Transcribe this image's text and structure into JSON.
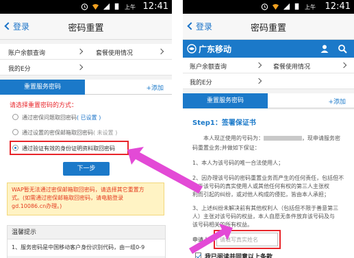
{
  "left": {
    "status": {
      "ampm": "上午",
      "time": "12:41"
    },
    "header": {
      "back": "登录",
      "title": "密码重置"
    },
    "menu": {
      "row1": [
        "账户余额查询",
        "套餐使用情况"
      ],
      "row2": [
        "我的E分"
      ]
    },
    "tabs": {
      "active": "重置服务密码",
      "add": "+添加"
    },
    "form": {
      "prompt": "请选择重置密码的方式：",
      "options": [
        {
          "text": "通过密保问题取回密码",
          "note": "( 已设置 )"
        },
        {
          "text": "通过设置的密保邮箱取回密码",
          "note": "( 未设置 )"
        },
        {
          "text": "通过验证有效的身份证明资料取回密码",
          "note": ""
        }
      ],
      "next": "下一步"
    },
    "notice": {
      "line1": "WAP暂无法通过密保邮箱取回密码，请选择其它重置方",
      "line2": "式。(如需通过密保邮箱取回密码，请电脑登录",
      "line3": "gd.10086.cn办理。)"
    },
    "tips": {
      "title": "温馨提示",
      "line1": "1、服务密码是中国移动客户身份识别代码，由一组0-9"
    }
  },
  "right": {
    "status": {
      "ampm": "上午",
      "time": "12:41"
    },
    "header": {
      "back": "登录",
      "title": "密码重置"
    },
    "brand": {
      "name": "广东移动"
    },
    "menu": {
      "row1": [
        "账户余额查询",
        "套餐使用情况"
      ],
      "row2": [
        "我的E分"
      ]
    },
    "tabs": {
      "active": "重置服务密码",
      "add": "+添加"
    },
    "doc": {
      "step": "Step1：签署保证书",
      "p1a": "本人现正使用的号码为：",
      "p1b": "，现申请服务密",
      "p1c": "码重置业务;并做如下保证：",
      "p2": "1、本人为该号码的唯一合法使用人；",
      "p3a": "2、因办理该号码的密码重置业务而产生的任何责任，包括但不",
      "p3b": "限于该号码的真实使用人或其他任何有权的第三人主张权",
      "p3c": "利而引起的纠纷，或对他人构成的侵犯，皆由本人承担；",
      "p4a": "3、上述纠纷未解决前有其他权利人（包括但不限于善意第三",
      "p4b": "人）主张对该号码的权益，本人自愿无条件放弃该号码及与",
      "p4c": "该号码相关的所有权益。",
      "applicant_label": "申请人：",
      "applicant_placeholder": "请填写真实姓名",
      "agree": "我已阅读并同意以上条款"
    }
  },
  "colors": {
    "accent": "#1b79c9",
    "highlight": "#e8252a",
    "pointer": "#e34ad6"
  }
}
